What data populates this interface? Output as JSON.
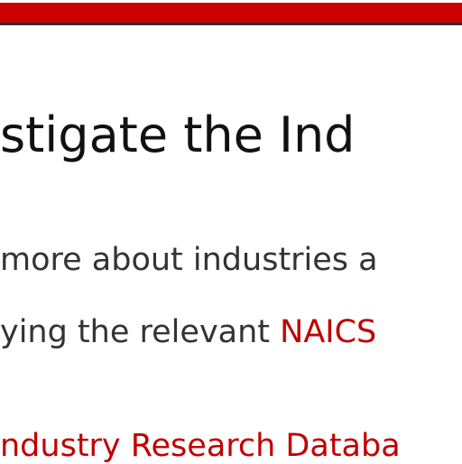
{
  "colors": {
    "brand": "#cc0000",
    "link": "#c00000"
  },
  "heading": "stigate the Ind",
  "paragraph": {
    "line1": "more about industries a",
    "line2_text": "ying the relevant ",
    "line2_link": "NAICS"
  },
  "resource_link": "ndustry Research Databa"
}
